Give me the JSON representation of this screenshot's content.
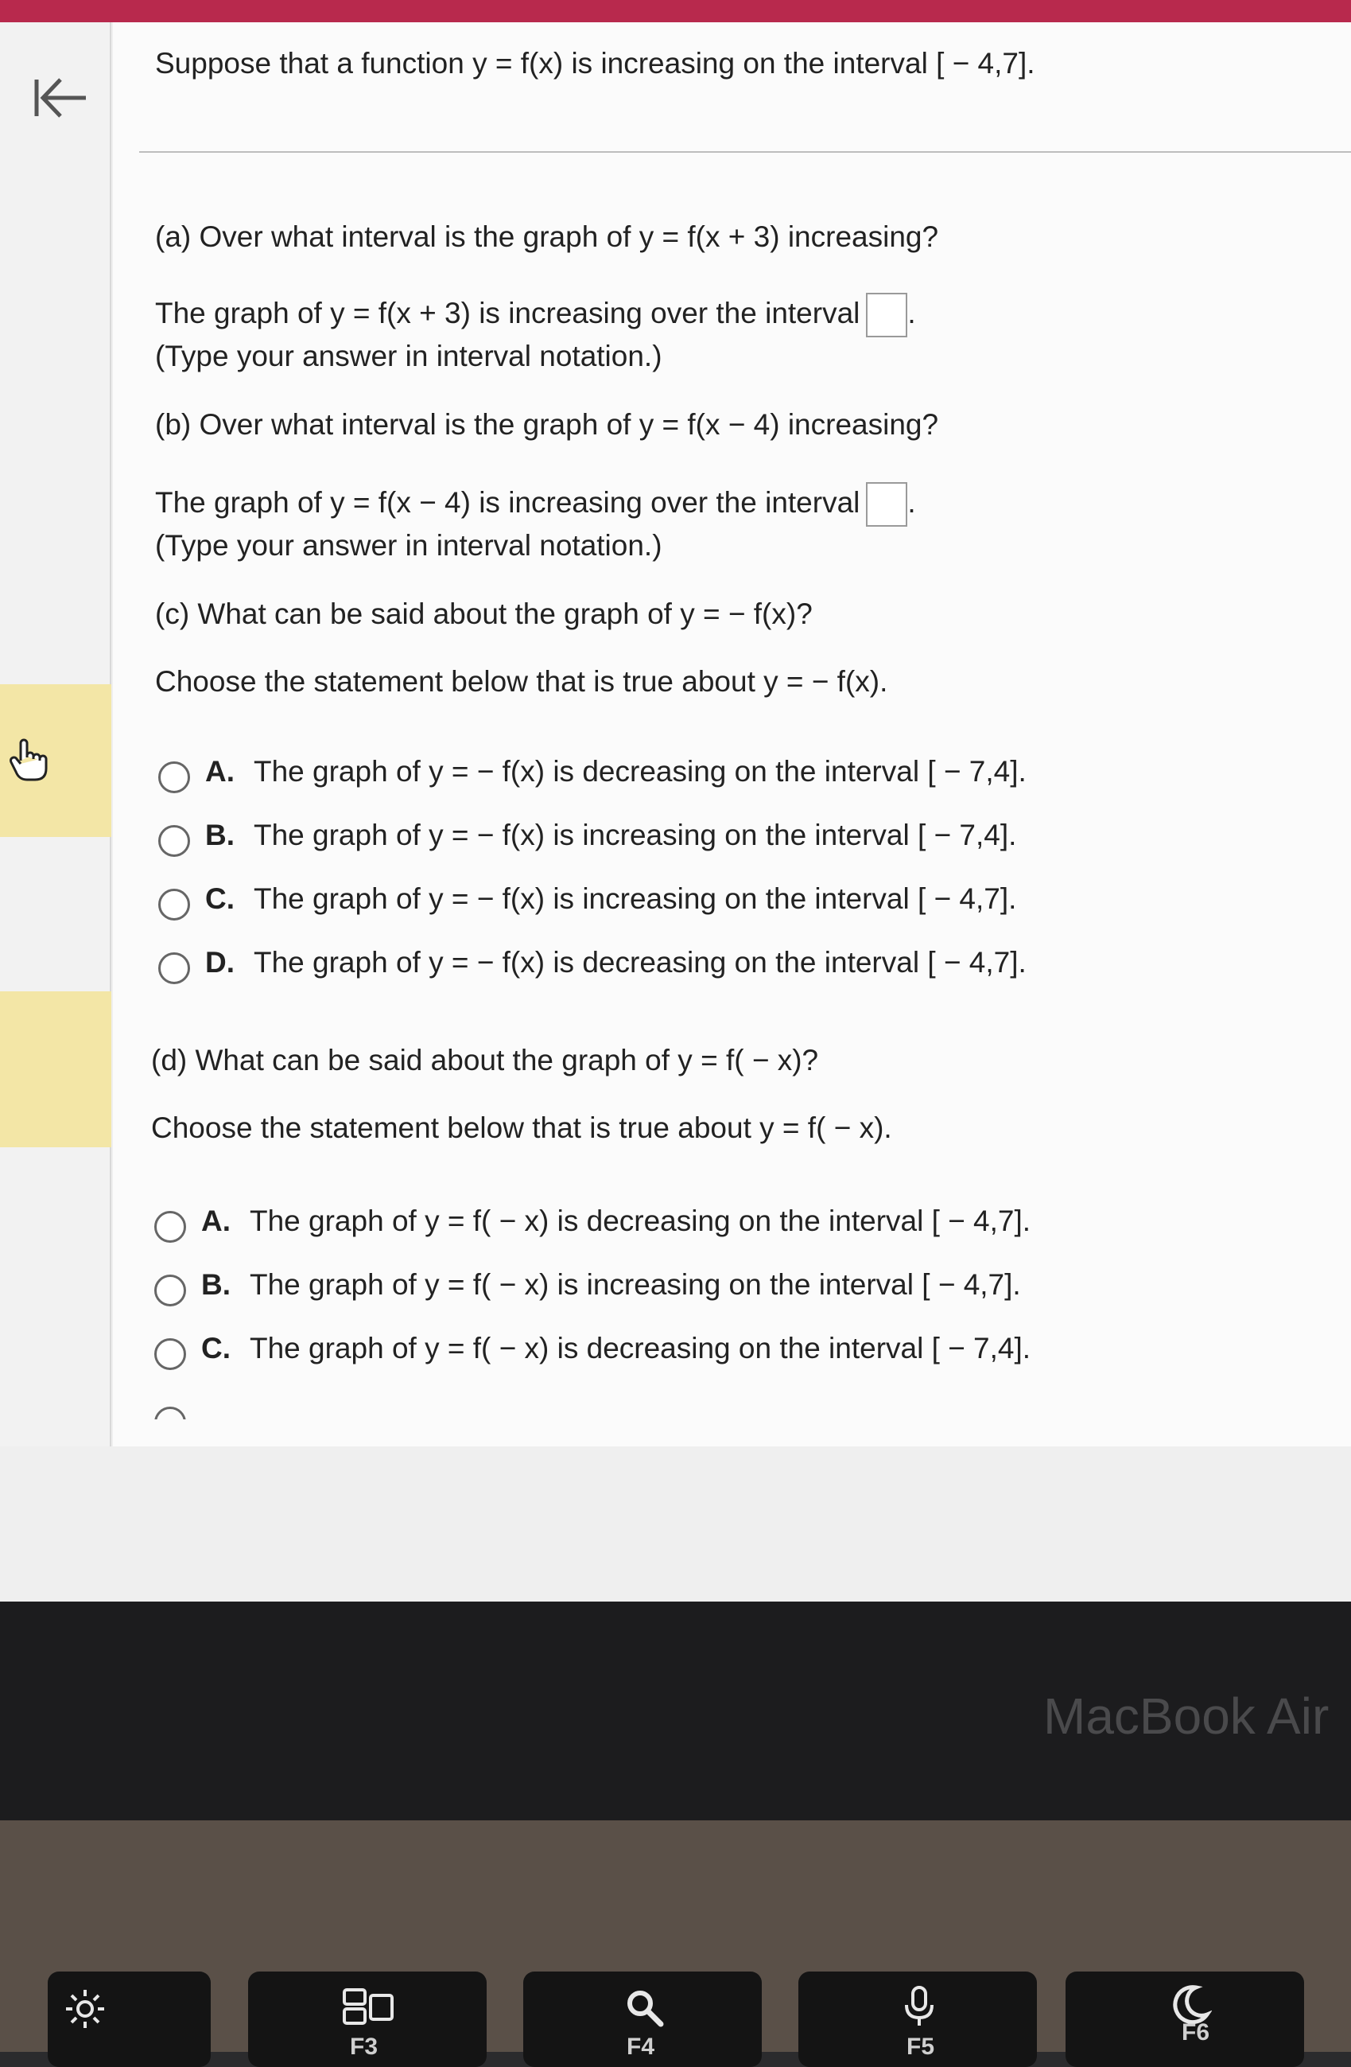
{
  "header": {
    "prompt": "Suppose that a function y = f(x) is increasing on the interval [ − 4,7]."
  },
  "part_a": {
    "question": "(a)  Over what interval is the graph of y = f(x + 3) increasing?",
    "answer_prefix": "The graph of y = f(x + 3) is increasing over the interval",
    "answer_suffix": ".",
    "hint": "(Type your answer in interval notation.)"
  },
  "part_b": {
    "question": "(b)  Over what interval is the graph of y = f(x − 4) increasing?",
    "answer_prefix": "The graph of y = f(x − 4) is increasing over the interval",
    "answer_suffix": ".",
    "hint": "(Type your answer in interval notation.)"
  },
  "part_c": {
    "question": "(c)  What can be said about the graph of y = − f(x)?",
    "instruction": "Choose the statement below that is true about y = − f(x).",
    "options": [
      {
        "letter": "A.",
        "text": "The graph of y = − f(x) is decreasing on the interval [ − 7,4]."
      },
      {
        "letter": "B.",
        "text": "The graph of y = − f(x) is increasing on the interval [ − 7,4]."
      },
      {
        "letter": "C.",
        "text": "The graph of y = − f(x) is increasing on the interval [ − 4,7]."
      },
      {
        "letter": "D.",
        "text": "The graph of y = − f(x) is decreasing on the interval [ − 4,7]."
      }
    ]
  },
  "part_d": {
    "question": "(d)  What can be said about the graph of y = f( − x)?",
    "instruction": "Choose the statement below that is true about y = f( − x).",
    "options": [
      {
        "letter": "A.",
        "text": "The graph of y = f( − x) is decreasing on the interval [ − 4,7]."
      },
      {
        "letter": "B.",
        "text": "The graph of y = f( − x) is increasing on the interval [ − 4,7]."
      },
      {
        "letter": "C.",
        "text": "The graph of y = f( − x) is decreasing on the interval [ − 7,4]."
      }
    ]
  },
  "device": {
    "brand": "MacBook Air"
  },
  "keys": [
    {
      "icon": "brightness-icon",
      "label": ""
    },
    {
      "icon": "mission-control-icon",
      "label": "F3"
    },
    {
      "icon": "search-icon",
      "label": "F4"
    },
    {
      "icon": "microphone-icon",
      "label": "F5"
    },
    {
      "icon": "moon-icon",
      "label": "F6"
    }
  ],
  "colors": {
    "highlight": "#f3e6a6",
    "topbar": "#b8294d"
  }
}
